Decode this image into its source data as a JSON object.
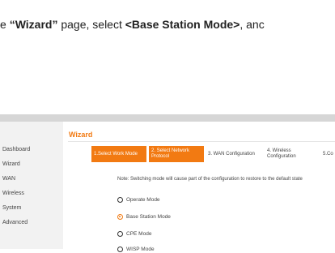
{
  "instruction": {
    "prefix": "e ",
    "page_name": "“Wizard”",
    "middle": " page, select ",
    "mode_name": "<Base Station Mode>",
    "suffix": ", anc"
  },
  "sidebar": {
    "items": [
      {
        "label": "Dashboard"
      },
      {
        "label": "Wizard"
      },
      {
        "label": "WAN"
      },
      {
        "label": "Wireless"
      },
      {
        "label": "System"
      },
      {
        "label": "Advanced"
      }
    ]
  },
  "wizard": {
    "title": "Wizard",
    "steps": [
      {
        "label": "1.Select Work Mode",
        "active": true
      },
      {
        "label": "2. Select Network Protocol",
        "active": true
      },
      {
        "label": "3. WAN Configuration",
        "active": false
      },
      {
        "label": "4. Wireless Configuration",
        "active": false
      },
      {
        "label": "5.Co",
        "active": false
      }
    ],
    "note": "Note: Switching mode will cause part of the configuration to restore to the default state",
    "modes": [
      {
        "label": "Operate Mode",
        "selected": false
      },
      {
        "label": "Base Station Mode",
        "selected": true
      },
      {
        "label": "CPE Mode",
        "selected": false
      },
      {
        "label": "WISP Mode",
        "selected": false
      }
    ]
  },
  "colors": {
    "accent": "#f27a12",
    "sidebar_bg": "#f2f2f2",
    "topbar": "#d6d6d6"
  }
}
